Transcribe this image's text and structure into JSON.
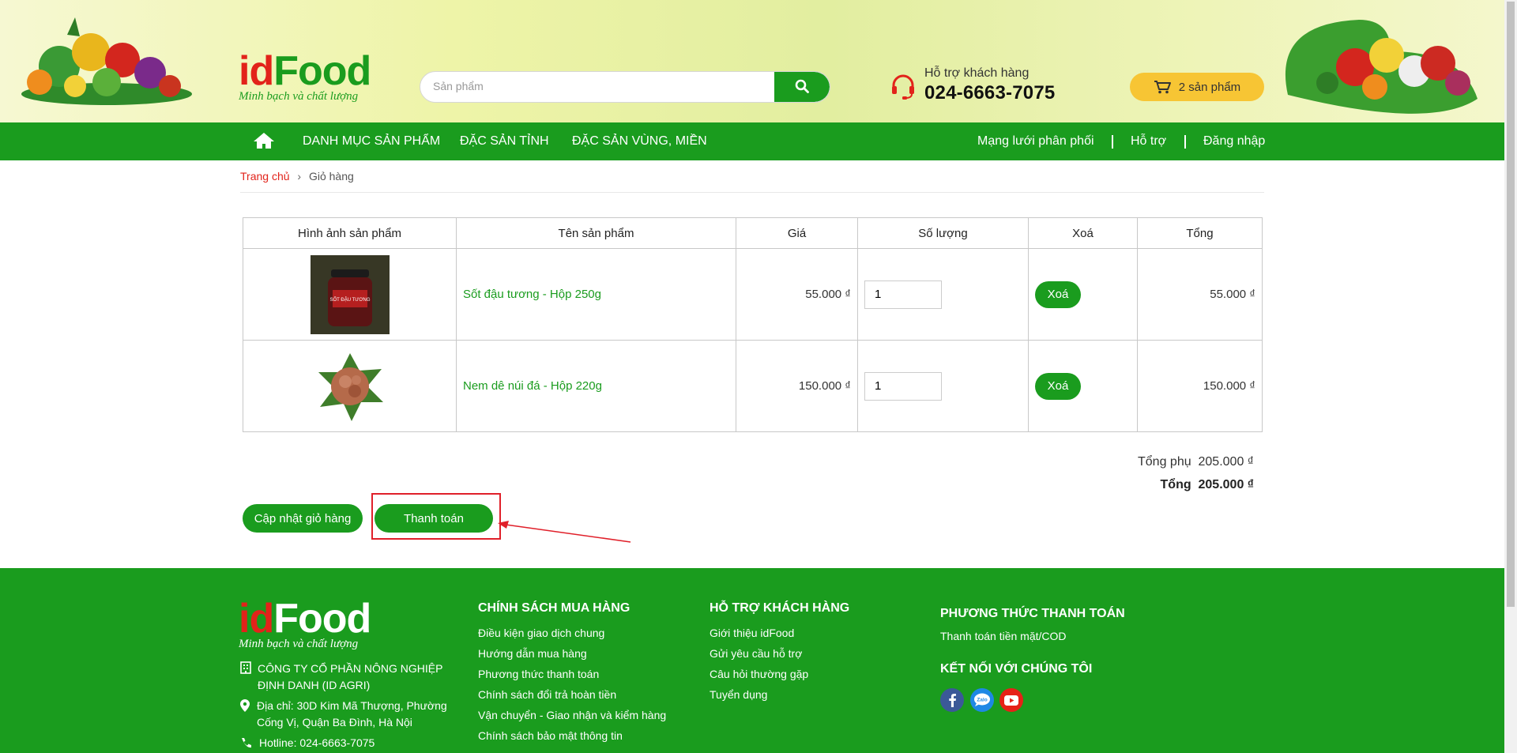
{
  "header": {
    "logo": {
      "id": "id",
      "food": "Food",
      "slogan": "Minh bạch và chất lượng"
    },
    "search": {
      "placeholder": "Sản phẩm",
      "value": ""
    },
    "support": {
      "label": "Hỗ trợ khách hàng",
      "phone": "024-6663-7075"
    },
    "cart": {
      "label": "2 sản phẩm"
    }
  },
  "nav": {
    "items": [
      "DANH MỤC SẢN PHẨM",
      "ĐẶC SẢN TỈNH",
      "ĐẶC SẢN VÙNG, MIỀN"
    ],
    "right": [
      "Mạng lưới phân phối",
      "Hỗ trợ",
      "Đăng nhập"
    ]
  },
  "breadcrumb": {
    "home": "Trang chủ",
    "separator": "›",
    "current": "Giỏ hàng"
  },
  "cart_table": {
    "headers": [
      "Hình ảnh sản phẩm",
      "Tên sản phẩm",
      "Giá",
      "Số lượng",
      "Xoá",
      "Tổng"
    ],
    "rows": [
      {
        "name": "Sốt đậu tương - Hộp 250g",
        "price": "55.000 ₫",
        "qty": "1",
        "delete": "Xoá",
        "total": "55.000 ₫",
        "thumb_label": "SỐT ĐẬU TƯƠNG"
      },
      {
        "name": "Nem dê núi đá - Hộp 220g",
        "price": "150.000 ₫",
        "qty": "1",
        "delete": "Xoá",
        "total": "150.000 ₫"
      }
    ]
  },
  "totals": {
    "subtotal_label": "Tổng phụ",
    "subtotal_value": "205.000 ₫",
    "total_label": "Tổng",
    "total_value": "205.000 ₫"
  },
  "actions": {
    "update_cart": "Cập nhật giỏ hàng",
    "checkout": "Thanh toán"
  },
  "footer": {
    "company": "CÔNG TY CỔ PHẦN NÔNG NGHIỆP ĐỊNH DANH (ID AGRI)",
    "address": "Địa chỉ: 30D Kim Mã Thượng, Phường Cống Vị, Quận Ba Đình, Hà Nội",
    "hotline": "Hotline: 024-6663-7075",
    "col1": {
      "title": "CHÍNH SÁCH MUA HÀNG",
      "links": [
        "Điều kiện giao dịch chung",
        "Hướng dẫn mua hàng",
        "Phương thức thanh toán",
        "Chính sách đổi trả hoàn tiền",
        "Vận chuyển - Giao nhận và kiểm hàng",
        "Chính sách bảo mật thông tin"
      ]
    },
    "col2": {
      "title": "HỖ TRỢ KHÁCH HÀNG",
      "links": [
        "Giới thiệu idFood",
        "Gửi yêu cầu hỗ trợ",
        "Câu hỏi thường gặp",
        "Tuyển dụng"
      ]
    },
    "col3": {
      "title": "PHƯƠNG THỨC THANH TOÁN",
      "text": "Thanh toán tiền mặt/COD",
      "connect_title": "KẾT NỐI VỚI CHÚNG TÔI",
      "zalo_label": "Zalo"
    }
  },
  "colors": {
    "brand_green": "#1a9c1e",
    "brand_red": "#e2231a",
    "cart_yellow": "#f7c534",
    "annotation_red": "#e0202a"
  },
  "icons": [
    "search-icon",
    "headset-icon",
    "cart-icon",
    "home-icon",
    "building-icon",
    "location-pin-icon",
    "phone-icon",
    "facebook-icon",
    "zalo-icon",
    "youtube-icon",
    "chevron-right-icon"
  ]
}
